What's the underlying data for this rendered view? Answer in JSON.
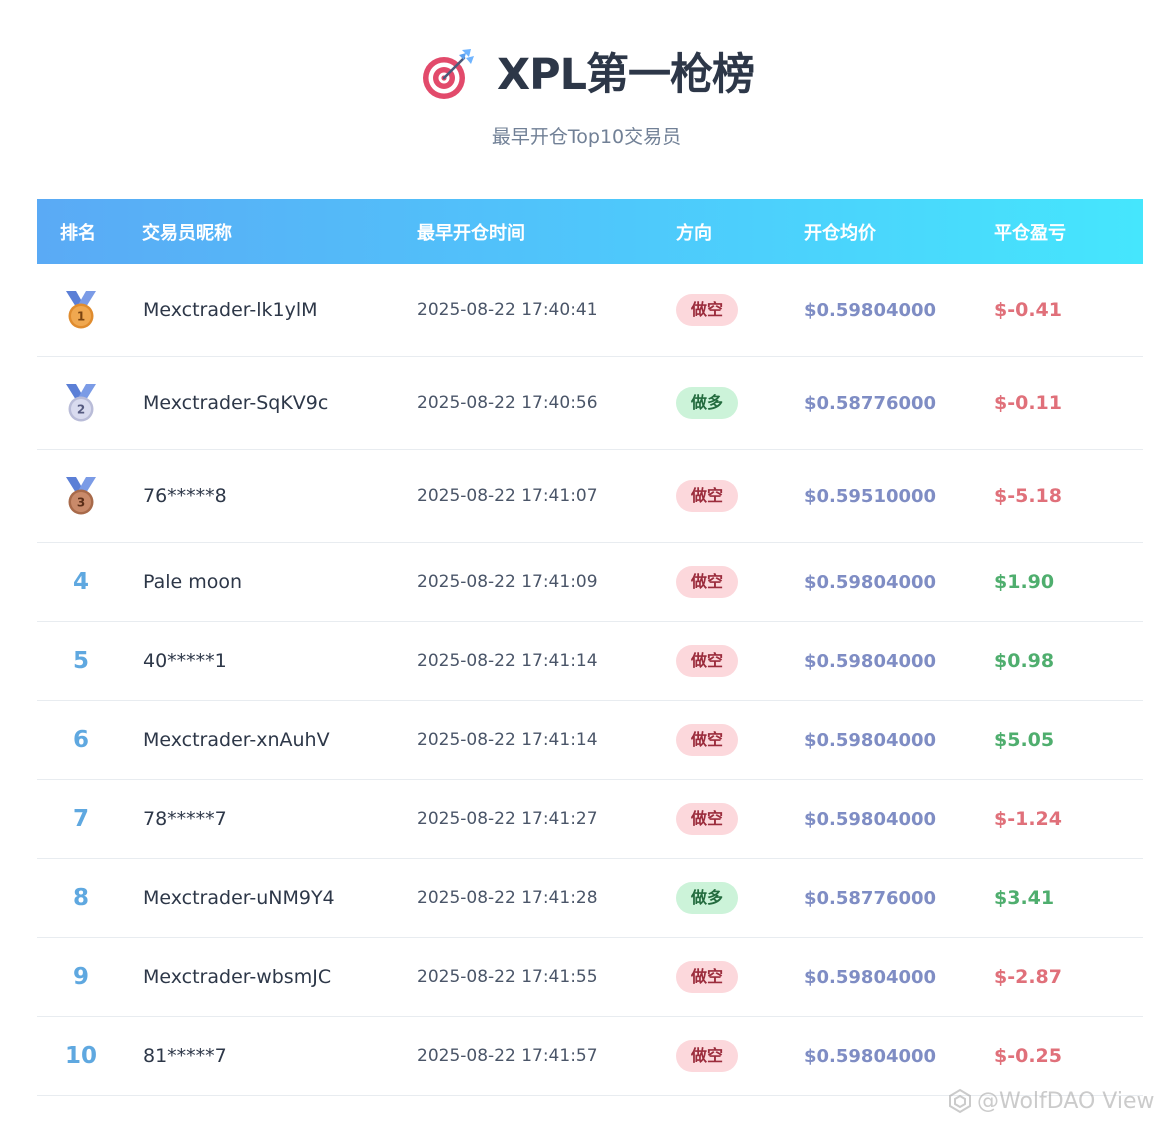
{
  "header": {
    "title": "XPL第一枪榜",
    "subtitle": "最早开仓Top10交易员",
    "icon": "dart-target-icon"
  },
  "table": {
    "columns": [
      "排名",
      "交易员昵称",
      "最早开仓时间",
      "方向",
      "开仓均价",
      "平仓盈亏"
    ],
    "rows": [
      {
        "rank": "1",
        "rank_icon": "gold-medal-icon",
        "name": "Mexctrader-lk1ylM",
        "time": "2025-08-22 17:40:41",
        "direction": "做空",
        "direction_type": "short",
        "price": "$0.59804000",
        "pnl": "$-0.41",
        "pnl_sign": "neg"
      },
      {
        "rank": "2",
        "rank_icon": "silver-medal-icon",
        "name": "Mexctrader-SqKV9c",
        "time": "2025-08-22 17:40:56",
        "direction": "做多",
        "direction_type": "long",
        "price": "$0.58776000",
        "pnl": "$-0.11",
        "pnl_sign": "neg"
      },
      {
        "rank": "3",
        "rank_icon": "bronze-medal-icon",
        "name": "76*****8",
        "time": "2025-08-22 17:41:07",
        "direction": "做空",
        "direction_type": "short",
        "price": "$0.59510000",
        "pnl": "$-5.18",
        "pnl_sign": "neg"
      },
      {
        "rank": "4",
        "name": "Pale moon",
        "time": "2025-08-22 17:41:09",
        "direction": "做空",
        "direction_type": "short",
        "price": "$0.59804000",
        "pnl": "$1.90",
        "pnl_sign": "pos"
      },
      {
        "rank": "5",
        "name": "40*****1",
        "time": "2025-08-22 17:41:14",
        "direction": "做空",
        "direction_type": "short",
        "price": "$0.59804000",
        "pnl": "$0.98",
        "pnl_sign": "pos"
      },
      {
        "rank": "6",
        "name": "Mexctrader-xnAuhV",
        "time": "2025-08-22 17:41:14",
        "direction": "做空",
        "direction_type": "short",
        "price": "$0.59804000",
        "pnl": "$5.05",
        "pnl_sign": "pos"
      },
      {
        "rank": "7",
        "name": "78*****7",
        "time": "2025-08-22 17:41:27",
        "direction": "做空",
        "direction_type": "short",
        "price": "$0.59804000",
        "pnl": "$-1.24",
        "pnl_sign": "neg"
      },
      {
        "rank": "8",
        "name": "Mexctrader-uNM9Y4",
        "time": "2025-08-22 17:41:28",
        "direction": "做多",
        "direction_type": "long",
        "price": "$0.58776000",
        "pnl": "$3.41",
        "pnl_sign": "pos"
      },
      {
        "rank": "9",
        "name": "Mexctrader-wbsmJC",
        "time": "2025-08-22 17:41:55",
        "direction": "做空",
        "direction_type": "short",
        "price": "$0.59804000",
        "pnl": "$-2.87",
        "pnl_sign": "neg"
      },
      {
        "rank": "10",
        "name": "81*****7",
        "time": "2025-08-22 17:41:57",
        "direction": "做空",
        "direction_type": "short",
        "price": "$0.59804000",
        "pnl": "$-0.25",
        "pnl_sign": "neg"
      }
    ]
  },
  "watermark": {
    "text": "@WolfDAO View",
    "icon": "platform-logo-icon"
  },
  "colors": {
    "header_gradient_start": "#5aaaf5",
    "header_gradient_end": "#45e6fd",
    "short_badge_bg": "#fcd8dc",
    "long_badge_bg": "#ccf3d9",
    "pnl_negative": "#e0707a",
    "pnl_positive": "#4fae6e",
    "price": "#7f8dc4",
    "rank": "#5fa8e0"
  }
}
